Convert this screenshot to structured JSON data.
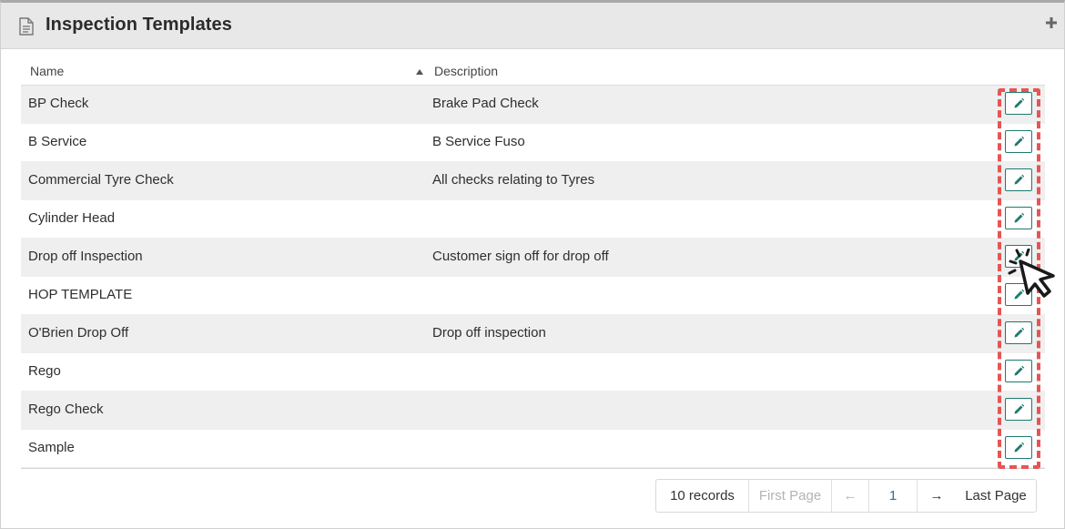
{
  "header": {
    "title": "Inspection Templates",
    "title_icon": "document-icon",
    "add_icon": "plus-icon"
  },
  "table": {
    "columns": {
      "name": "Name",
      "description": "Description",
      "sort_icon": "sort-ascending-icon"
    },
    "rows": [
      {
        "name": "BP Check",
        "description": "Brake Pad Check"
      },
      {
        "name": "B Service",
        "description": "B Service Fuso"
      },
      {
        "name": "Commercial Tyre Check",
        "description": "All checks relating to Tyres"
      },
      {
        "name": "Cylinder Head",
        "description": ""
      },
      {
        "name": "Drop off Inspection",
        "description": "Customer sign off for drop off"
      },
      {
        "name": "HOP TEMPLATE",
        "description": ""
      },
      {
        "name": "O'Brien Drop Off",
        "description": "Drop off inspection"
      },
      {
        "name": "Rego",
        "description": ""
      },
      {
        "name": "Rego Check",
        "description": ""
      },
      {
        "name": "Sample",
        "description": ""
      }
    ],
    "row_action_icon": "pencil-icon"
  },
  "pagination": {
    "records": "10 records",
    "first": "First Page",
    "prev": "←",
    "page": "1",
    "next": "→",
    "last": "Last Page"
  },
  "colors": {
    "accent": "#1f7a6c",
    "highlight": "#e65555",
    "page_link": "#2a6fa8"
  }
}
